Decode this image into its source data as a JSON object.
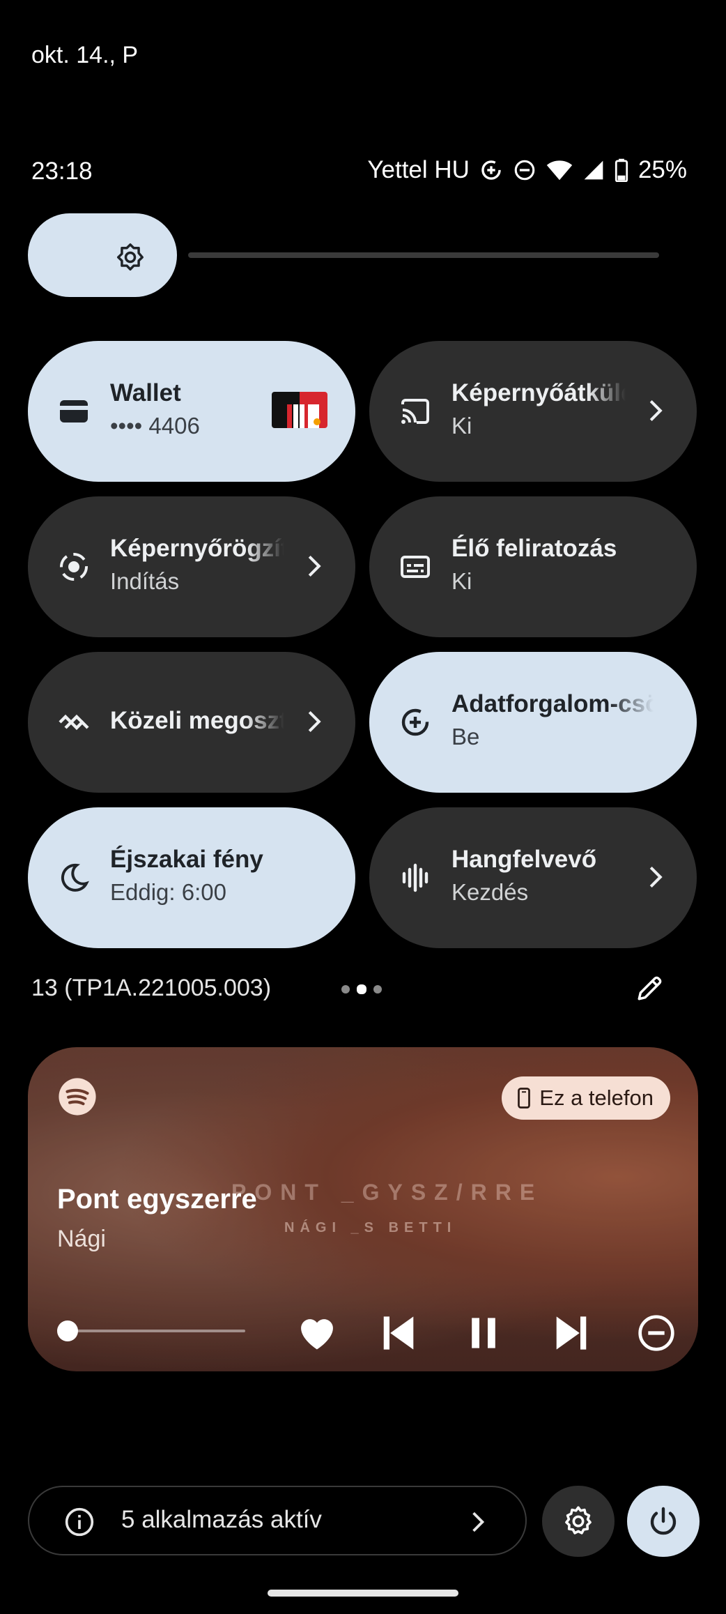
{
  "status_bar": {
    "date": "okt. 14., P",
    "time": "23:18",
    "carrier": "Yettel HU",
    "battery": "25%",
    "icons": [
      "data-saver-icon",
      "do-not-disturb-icon",
      "wifi-icon",
      "signal-icon",
      "battery-icon"
    ]
  },
  "brightness": {
    "level": 0.12,
    "icon": "brightness-icon"
  },
  "tiles": [
    {
      "label": "Wallet",
      "sub": "•••• 4406",
      "state": "on",
      "icon": "wallet-icon"
    },
    {
      "label": "Képernyőátküldés",
      "sub": "Ki",
      "state": "off",
      "icon": "cast-icon"
    },
    {
      "label": "Képernyőrögzítés",
      "sub": "Indítás",
      "state": "off",
      "icon": "screen-record-icon"
    },
    {
      "label": "Élő feliratozás",
      "sub": "Ki",
      "state": "off",
      "icon": "live-caption-icon"
    },
    {
      "label": "Közeli megosztás",
      "sub": "",
      "state": "off",
      "icon": "nearby-share-icon"
    },
    {
      "label": "Adatforgalom-csökkentő",
      "sub": "Be",
      "state": "on",
      "icon": "data-saver-icon"
    },
    {
      "label": "Éjszakai fény",
      "sub": "Eddig: 6:00",
      "state": "on",
      "icon": "night-light-icon"
    },
    {
      "label": "Hangfelvevő",
      "sub": "Kezdés",
      "state": "off",
      "icon": "recorder-icon"
    }
  ],
  "build": "13 (TP1A.221005.003)",
  "pager": {
    "pages": 3,
    "active": 2
  },
  "media": {
    "app": "Spotify",
    "device": "Ez a telefon",
    "title": "Pont egyszerre",
    "artist": "Nági",
    "art_text_1": "PONT _GYSZ/RRE",
    "art_text_2": "NÁGI _S BETTI",
    "progress": 0.02
  },
  "footer": {
    "active_apps": "5 alkalmazás aktív"
  },
  "colors": {
    "tile_on": "#d6e3f0",
    "tile_off": "#2e2e2e",
    "background": "#000000"
  }
}
